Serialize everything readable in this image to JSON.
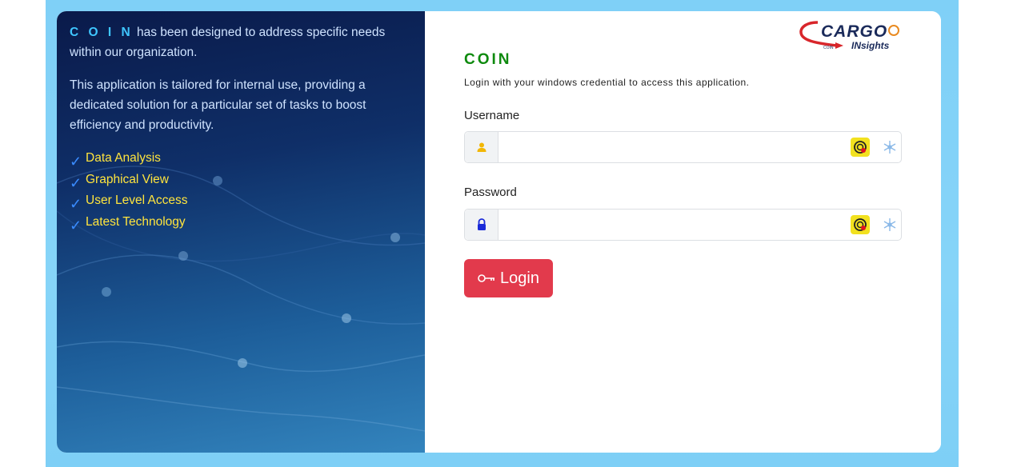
{
  "left_panel": {
    "brand": "C O I N",
    "intro_rest": " has been designed to address specific needs within our organization.",
    "description": "This application is tailored for internal use, providing a dedicated solution for a particular set of tasks to boost efficiency and productivity.",
    "features": [
      "Data Analysis",
      "Graphical View",
      "User Level Access",
      "Latest Technology"
    ],
    "check_glyph": "✓"
  },
  "logo": {
    "top": "CARGO",
    "bottom": "INsights",
    "tiny": "COIN"
  },
  "form": {
    "title": "COIN",
    "subtitle": "Login with your windows credential to access this application.",
    "username_label": "Username",
    "username_value": "",
    "password_label": "Password",
    "password_value": "",
    "login_label": "Login"
  },
  "colors": {
    "title_green": "#0e8a0e",
    "login_red": "#e23a4c",
    "feature_yellow": "#ffe43d",
    "brand_cyan": "#3fc6ff"
  },
  "icons": {
    "username_addon": "user-icon",
    "password_addon": "lock-icon",
    "extension": "password-manager-icon",
    "extension2": "snowflake-icon",
    "login": "key-icon"
  }
}
